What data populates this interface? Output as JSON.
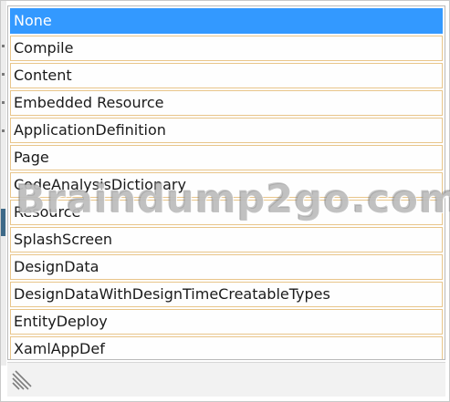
{
  "dropdown": {
    "selected_index": 0,
    "items": [
      {
        "label": "None"
      },
      {
        "label": "Compile"
      },
      {
        "label": "Content"
      },
      {
        "label": "Embedded Resource"
      },
      {
        "label": "ApplicationDefinition"
      },
      {
        "label": "Page"
      },
      {
        "label": "CodeAnalysisDictionary"
      },
      {
        "label": "Resource"
      },
      {
        "label": "SplashScreen"
      },
      {
        "label": "DesignData"
      },
      {
        "label": "DesignDataWithDesignTimeCreatableTypes"
      },
      {
        "label": "EntityDeploy"
      },
      {
        "label": "XamlAppDef"
      }
    ]
  },
  "watermark": {
    "text": "Braindump2go.com"
  },
  "colors": {
    "selection": "#3399ff",
    "item_border": "#e8c58a",
    "side_tab": "#3e6a88"
  },
  "icons": {
    "resize_grip": "resize-grip-icon"
  }
}
